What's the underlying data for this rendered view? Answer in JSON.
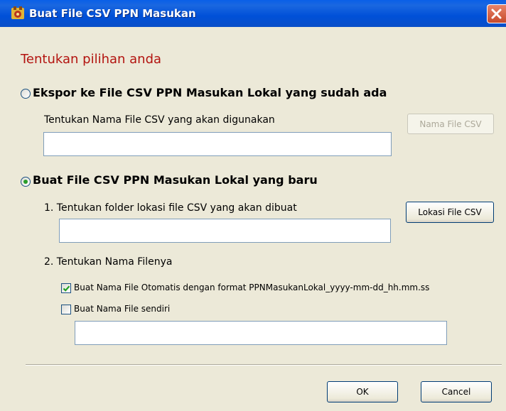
{
  "window": {
    "title": "Buat File CSV PPN Masukan",
    "icon": "app-icon",
    "close_icon": "close-icon"
  },
  "heading": "Tentukan pilihan anda",
  "option_existing": {
    "label": "Ekspor ke  File CSV PPN Masukan Lokal yang sudah ada",
    "selected": false,
    "file_label": "Tentukan Nama File  CSV yang akan digunakan",
    "file_value": "",
    "button_label": "Nama File CSV",
    "button_enabled": false
  },
  "option_new": {
    "label": "Buat File CSV PPN Masukan Lokal yang baru",
    "selected": true,
    "folder_label": "1. Tentukan folder lokasi file  CSV yang akan dibuat",
    "folder_value": "",
    "folder_button_label": "Lokasi File CSV",
    "name_label": "2. Tentukan Nama Filenya",
    "auto_checkbox": {
      "label": "Buat Nama File Otomatis dengan format PPNMasukanLokal_yyyy-mm-dd_hh.mm.ss",
      "checked": true
    },
    "custom_checkbox": {
      "label": "Buat Nama File sendiri",
      "checked": false
    },
    "custom_value": ""
  },
  "footer": {
    "ok_label": "OK",
    "cancel_label": "Cancel"
  }
}
